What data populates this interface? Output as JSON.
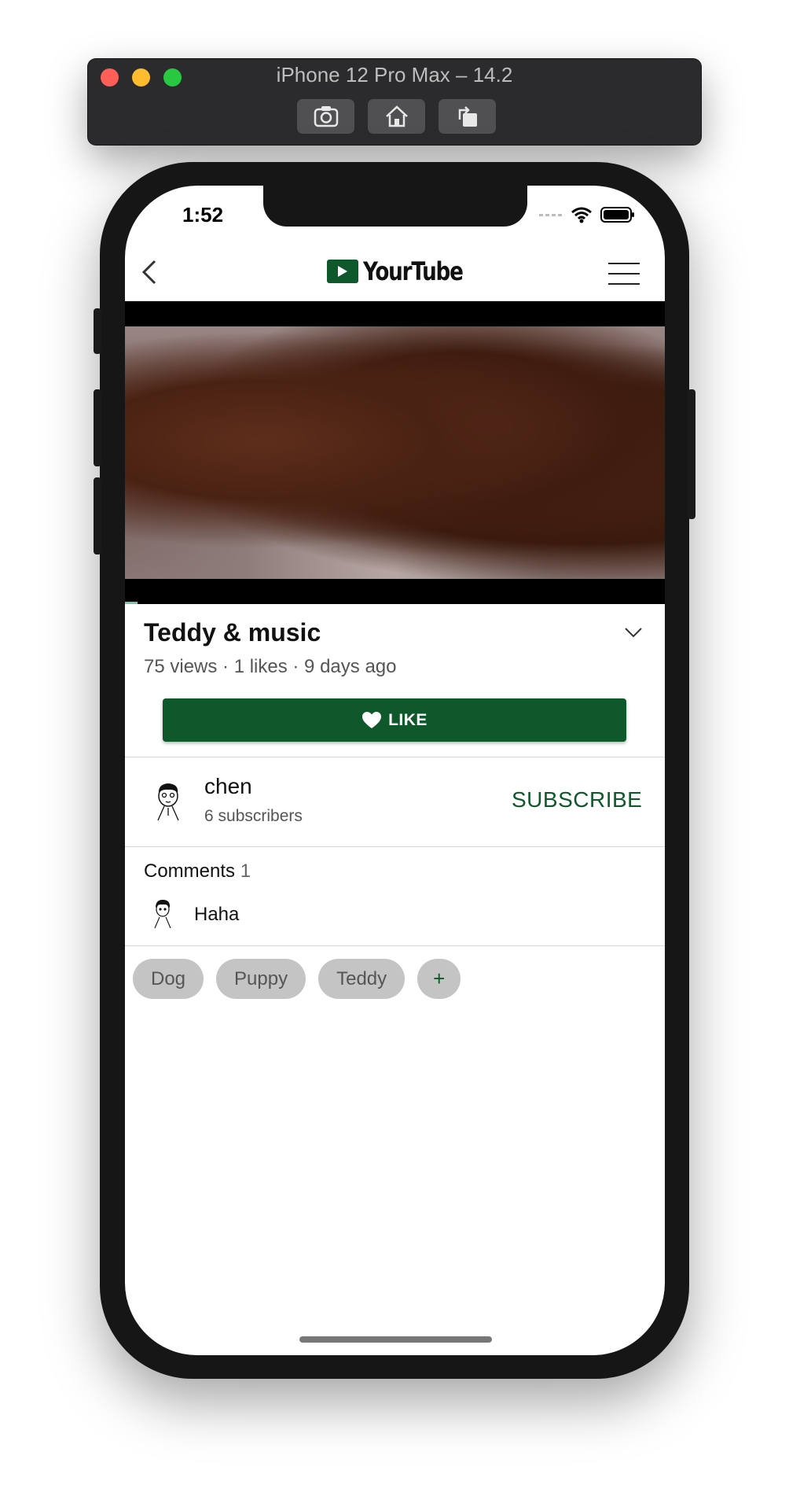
{
  "simulator": {
    "title": "iPhone 12 Pro Max – 14.2",
    "buttons": [
      "screenshot-icon",
      "home-icon",
      "rotate-icon"
    ]
  },
  "status_bar": {
    "time": "1:52"
  },
  "header": {
    "logo_text": "YourTube",
    "brand_color": "#0e582c"
  },
  "video": {
    "title": "Teddy & music",
    "meta": "75 views · 1 likes · 9 days ago",
    "like_label": "LIKE"
  },
  "channel": {
    "name": "chen",
    "subscribers": "6 subscribers",
    "subscribe_label": "SUBSCRIBE"
  },
  "comments": {
    "label": "Comments",
    "count": "1",
    "items": [
      {
        "text": "Haha"
      }
    ]
  },
  "tags": [
    "Dog",
    "Puppy",
    "Teddy"
  ],
  "add_tag_label": "+"
}
